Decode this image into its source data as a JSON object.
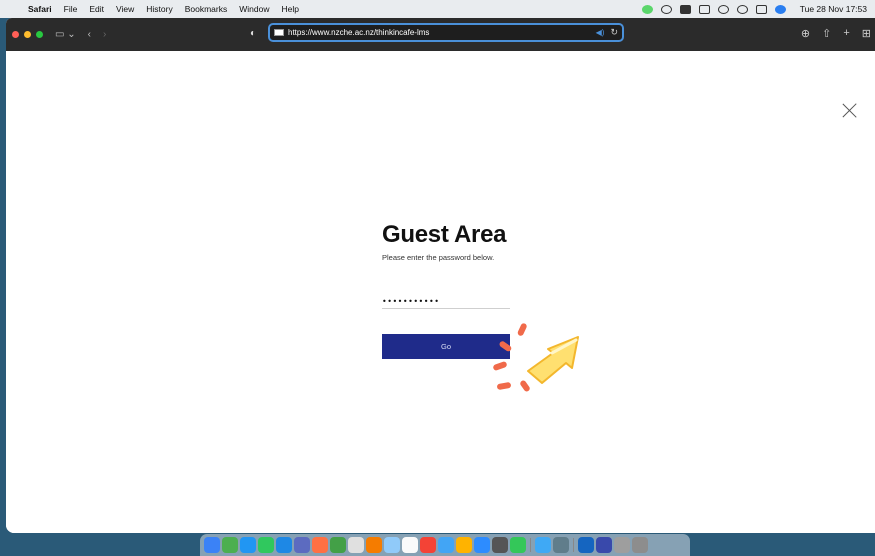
{
  "menubar": {
    "apple_icon": "apple-logo-icon",
    "app_name": "Safari",
    "items": [
      "File",
      "Edit",
      "View",
      "History",
      "Bookmarks",
      "Window",
      "Help"
    ],
    "clock": "Tue 28 Nov  17:53"
  },
  "browser": {
    "url": "https://www.nzche.ac.nz/thinkincafe-lms"
  },
  "page": {
    "title": "Guest Area",
    "subtitle": "Please enter the password below.",
    "password_value": "•••••••••••",
    "go_label": "Go"
  },
  "dock": {
    "apps": [
      "#3b82f6",
      "#4caf50",
      "#2196f3",
      "#30c85e",
      "#1e88e5",
      "#5c6bc0",
      "#ff7043",
      "#43a047",
      "#e0e0e0",
      "#f57c00",
      "#90caf9",
      "#fafafa",
      "#f44336",
      "#42a5f5",
      "#ffb300",
      "#2d8cff",
      "#555555",
      "#34c759",
      "#3fa9f5",
      "#607d8b",
      "#1565c0",
      "#3949ab",
      "#9e9e9e",
      "#8d8d8d"
    ]
  }
}
